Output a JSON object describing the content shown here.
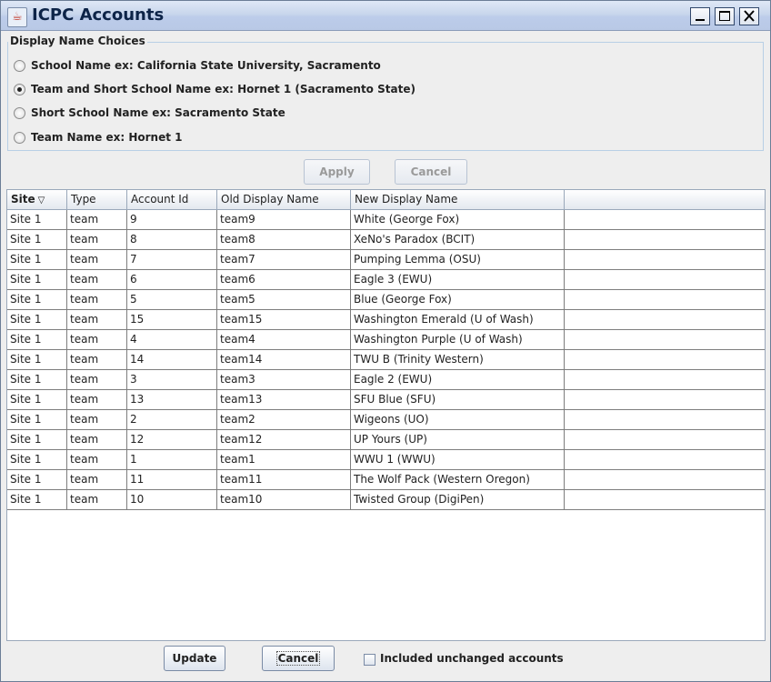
{
  "window": {
    "title": "ICPC Accounts",
    "controls": [
      "minimize-icon",
      "maximize-icon",
      "close-icon"
    ]
  },
  "display_name_choices": {
    "label": "Display Name Choices",
    "options": [
      {
        "label": "School Name ex:  California State University, Sacramento",
        "selected": false
      },
      {
        "label": "Team and Short School Name ex: Hornet 1 (Sacramento State)",
        "selected": true
      },
      {
        "label": "Short School Name ex: Sacramento State",
        "selected": false
      },
      {
        "label": "Team Name ex: Hornet 1",
        "selected": false
      }
    ]
  },
  "top_buttons": {
    "apply": "Apply",
    "cancel": "Cancel"
  },
  "table": {
    "columns": [
      "Site",
      "Type",
      "Account Id",
      "Old Display Name",
      "New Display Name",
      ""
    ],
    "sorted_column": "Site",
    "sort_indicator": "▽",
    "rows": [
      [
        "Site 1",
        "team",
        "9",
        "team9",
        "White (George Fox)"
      ],
      [
        "Site 1",
        "team",
        "8",
        "team8",
        "XeNo's Paradox (BCIT)"
      ],
      [
        "Site 1",
        "team",
        "7",
        "team7",
        "Pumping Lemma (OSU)"
      ],
      [
        "Site 1",
        "team",
        "6",
        "team6",
        "Eagle 3 (EWU)"
      ],
      [
        "Site 1",
        "team",
        "5",
        "team5",
        "Blue (George Fox)"
      ],
      [
        "Site 1",
        "team",
        "15",
        "team15",
        "Washington Emerald (U of Wash)"
      ],
      [
        "Site 1",
        "team",
        "4",
        "team4",
        "Washington Purple (U of Wash)"
      ],
      [
        "Site 1",
        "team",
        "14",
        "team14",
        "TWU B (Trinity Western)"
      ],
      [
        "Site 1",
        "team",
        "3",
        "team3",
        "Eagle 2 (EWU)"
      ],
      [
        "Site 1",
        "team",
        "13",
        "team13",
        "SFU Blue (SFU)"
      ],
      [
        "Site 1",
        "team",
        "2",
        "team2",
        "Wigeons (UO)"
      ],
      [
        "Site 1",
        "team",
        "12",
        "team12",
        "UP Yours (UP)"
      ],
      [
        "Site 1",
        "team",
        "1",
        "team1",
        "WWU 1 (WWU)"
      ],
      [
        "Site 1",
        "team",
        "11",
        "team11",
        "The Wolf Pack (Western Oregon)"
      ],
      [
        "Site 1",
        "team",
        "10",
        "team10",
        "Twisted Group (DigiPen)"
      ]
    ]
  },
  "footer": {
    "update": "Update",
    "cancel": "Cancel",
    "include_unchanged_label": "Included unchanged accounts",
    "include_unchanged_checked": false
  },
  "colors": {
    "titlebar": "#c8d6ec",
    "title_text": "#0d2448",
    "window_bg": "#eeeeee",
    "grid_line": "#7d7d7d"
  }
}
